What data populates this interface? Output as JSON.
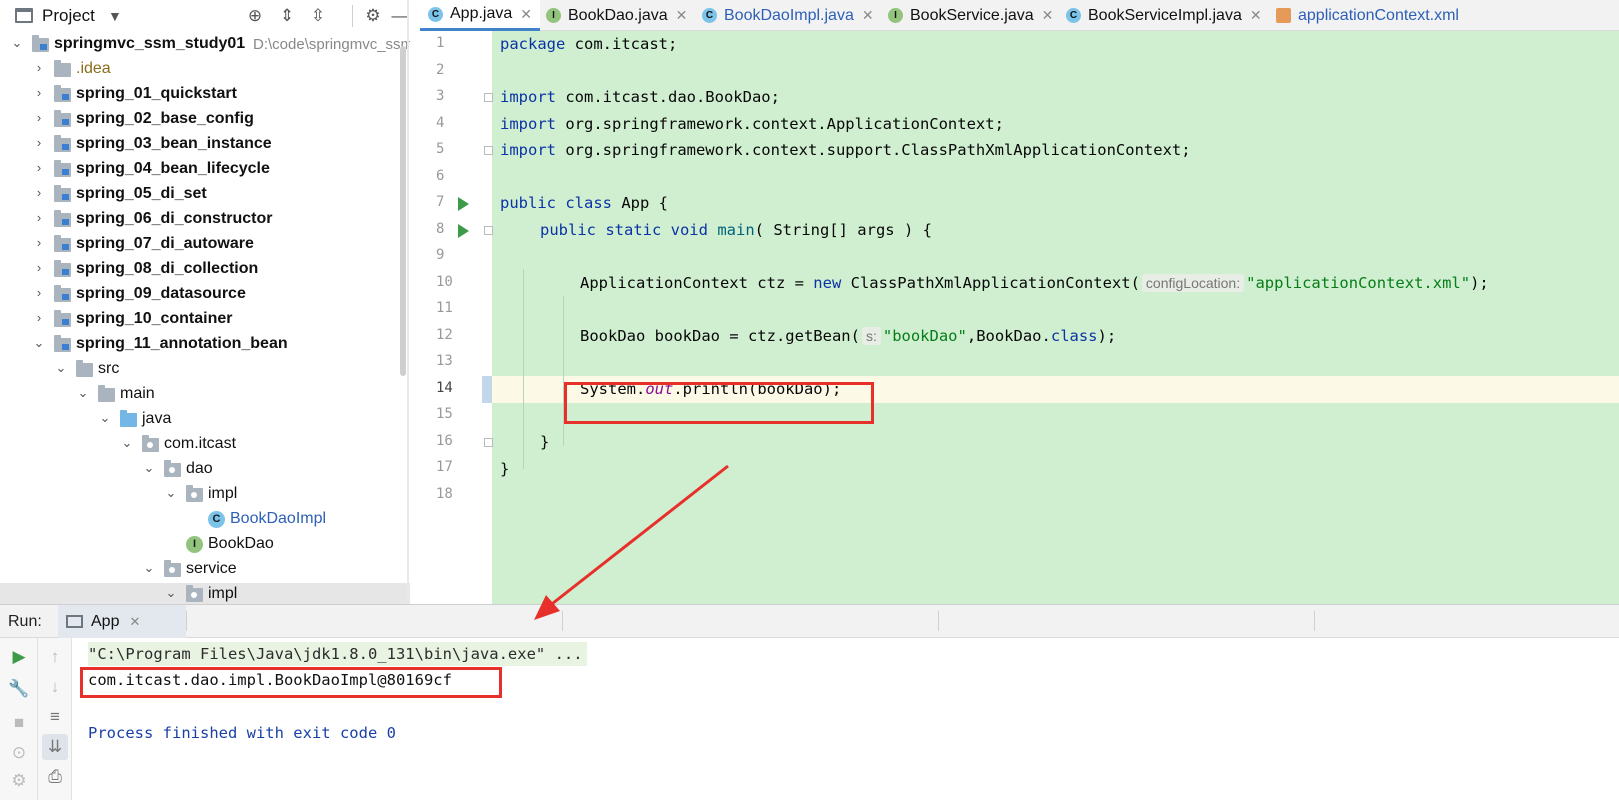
{
  "project_panel": {
    "title": "Project",
    "tree": [
      {
        "label": "springmvc_ssm_study01",
        "path": "D:\\code\\springmvc_ssm",
        "level": 0,
        "type": "module",
        "expanded": true,
        "bold": true
      },
      {
        "label": ".idea",
        "level": 1,
        "type": "folder",
        "expanded": false,
        "color": "orange"
      },
      {
        "label": "spring_01_quickstart",
        "level": 1,
        "type": "module",
        "expanded": false,
        "bold": true
      },
      {
        "label": "spring_02_base_config",
        "level": 1,
        "type": "module",
        "expanded": false,
        "bold": true
      },
      {
        "label": "spring_03_bean_instance",
        "level": 1,
        "type": "module",
        "expanded": false,
        "bold": true
      },
      {
        "label": "spring_04_bean_lifecycle",
        "level": 1,
        "type": "module",
        "expanded": false,
        "bold": true
      },
      {
        "label": "spring_05_di_set",
        "level": 1,
        "type": "module",
        "expanded": false,
        "bold": true
      },
      {
        "label": "spring_06_di_constructor",
        "level": 1,
        "type": "module",
        "expanded": false,
        "bold": true
      },
      {
        "label": "spring_07_di_autoware",
        "level": 1,
        "type": "module",
        "expanded": false,
        "bold": true
      },
      {
        "label": "spring_08_di_collection",
        "level": 1,
        "type": "module",
        "expanded": false,
        "bold": true
      },
      {
        "label": "spring_09_datasource",
        "level": 1,
        "type": "module",
        "expanded": false,
        "bold": true
      },
      {
        "label": "spring_10_container",
        "level": 1,
        "type": "module",
        "expanded": false,
        "bold": true
      },
      {
        "label": "spring_11_annotation_bean",
        "level": 1,
        "type": "module",
        "expanded": true,
        "bold": true
      },
      {
        "label": "src",
        "level": 2,
        "type": "folder",
        "expanded": true
      },
      {
        "label": "main",
        "level": 3,
        "type": "folder",
        "expanded": true
      },
      {
        "label": "java",
        "level": 4,
        "type": "source",
        "expanded": true
      },
      {
        "label": "com.itcast",
        "level": 5,
        "type": "package",
        "expanded": true
      },
      {
        "label": "dao",
        "level": 6,
        "type": "package",
        "expanded": true
      },
      {
        "label": "impl",
        "level": 7,
        "type": "package",
        "expanded": true
      },
      {
        "label": "BookDaoImpl",
        "level": 8,
        "type": "class",
        "color": "blue"
      },
      {
        "label": "BookDao",
        "level": 7,
        "type": "interface"
      },
      {
        "label": "service",
        "level": 6,
        "type": "package",
        "expanded": true
      },
      {
        "label": "impl",
        "level": 7,
        "type": "package",
        "expanded": true
      }
    ]
  },
  "tabs": [
    {
      "label": "App.java",
      "icon": "class-run-icon",
      "active": true
    },
    {
      "label": "BookDao.java",
      "icon": "interface-icon",
      "active": false
    },
    {
      "label": "BookDaoImpl.java",
      "icon": "class-icon",
      "active": false,
      "color": "blue"
    },
    {
      "label": "BookService.java",
      "icon": "interface-icon",
      "active": false
    },
    {
      "label": "BookServiceImpl.java",
      "icon": "class-icon",
      "active": false
    },
    {
      "label": "applicationContext.xml",
      "icon": "xml-icon",
      "active": false,
      "color": "blue"
    }
  ],
  "editor": {
    "line_numbers": [
      "1",
      "2",
      "3",
      "4",
      "5",
      "6",
      "7",
      "8",
      "9",
      "10",
      "11",
      "12",
      "13",
      "14",
      "15",
      "16",
      "17",
      "18"
    ],
    "current_line": "14",
    "code": {
      "l1_kw": "package",
      "l1_rest": " com.itcast;",
      "l3_kw": "import",
      "l3_rest": " com.itcast.dao.BookDao;",
      "l4_kw": "import",
      "l4_rest": " org.springframework.context.ApplicationContext;",
      "l5_kw": "import",
      "l5_rest": " org.springframework.context.support.ClassPathXmlApplicationContext;",
      "l7_kw": "public class",
      "l7_rest": " App {",
      "l8_kw": "public static void",
      "l8_fn": "main",
      "l8_rest": "( String[] args ) {",
      "l10_a": "ApplicationContext ctz = ",
      "l10_kw": "new",
      "l10_b": " ClassPathXmlApplicationContext(",
      "l10_hint": "configLocation:",
      "l10_str": "\"applicationContext.xml\"",
      "l10_c": ");",
      "l12_a": "BookDao bookDao = ctz.getBean(",
      "l12_hint": "s:",
      "l12_str": "\"bookDao\"",
      "l12_b": ",BookDao.",
      "l12_kw": "class",
      "l12_c": ");",
      "l14_a": "System.",
      "l14_static": "out",
      "l14_b": ".println(bookDao);",
      "l16": "}",
      "l17": "}"
    }
  },
  "run_panel": {
    "label": "Run:",
    "tab_label": "App",
    "console": {
      "command": "\"C:\\Program Files\\Java\\jdk1.8.0_131\\bin\\java.exe\" ...",
      "output": "com.itcast.dao.impl.BookDaoImpl@80169cf",
      "exit": "Process finished with exit code 0"
    }
  },
  "colors": {
    "editor_bg": "#d0efd1",
    "highlight_red": "#e8302a",
    "keyword": "#0b33a5",
    "string": "#067d17"
  }
}
